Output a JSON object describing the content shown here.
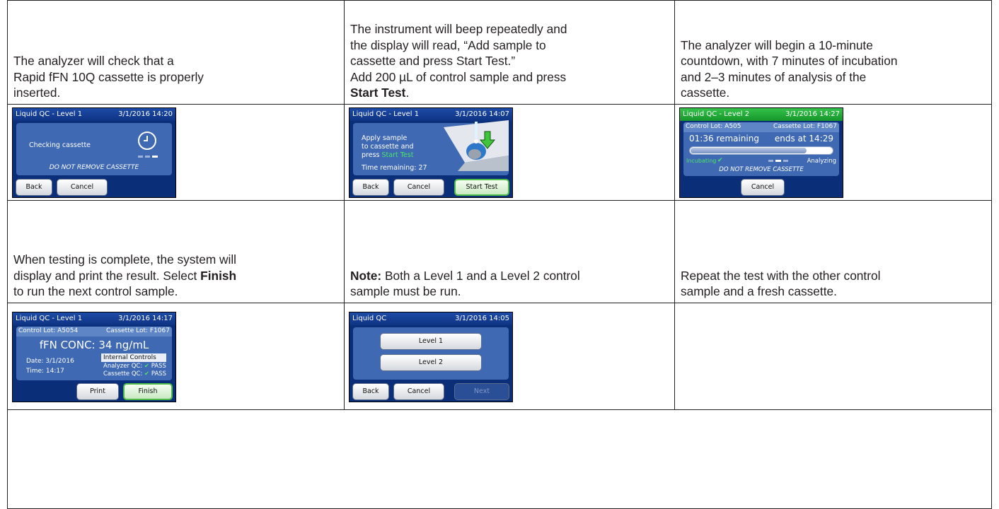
{
  "instructions": {
    "r1c1": [
      "The analyzer will check that a",
      "Rapid fFN 10Q cassette is properly",
      "inserted."
    ],
    "r1c2_pre": [
      "The instrument will beep repeatedly and",
      "the display will read, “Add sample to",
      "cassette and press Start Test.”",
      "Add 200 µL of control sample and press"
    ],
    "r1c2_bold": "Start Test",
    "r1c2_end": ".",
    "r1c3": [
      "The analyzer will begin a 10-minute",
      "countdown, with 7 minutes of incubation",
      "and 2–3 minutes of analysis of the",
      "cassette."
    ],
    "r2c1_pre": [
      "When testing is complete, the system will",
      "display and print the result. Select "
    ],
    "r2c1_bold": "Finish",
    "r2c1_post": "to run the next control sample.",
    "r2c2_bold": "Note:",
    "r2c2_post": [
      " Both a Level 1 and a Level 2 control",
      "sample must be run."
    ],
    "r2c3": [
      "Repeat the test with the other control",
      "sample and a fresh cassette."
    ]
  },
  "screens": {
    "s1": {
      "title": "Liquid QC - Level 1",
      "datetime": "3/1/2016 14:20",
      "message": "Checking cassette",
      "warning": "DO NOT REMOVE CASSETTE",
      "back": "Back",
      "cancel": "Cancel"
    },
    "s2": {
      "title": "Liquid QC - Level 1",
      "datetime": "3/1/2016 14:07",
      "line1": "Apply sample",
      "line2": "to cassette and",
      "line3": "press",
      "start_word": "Start Test",
      "time_remaining": "Time remaining: 27",
      "back": "Back",
      "cancel": "Cancel",
      "start": "Start Test"
    },
    "s3": {
      "title": "Liquid QC - Level 2",
      "datetime": "3/1/2016 14:27",
      "control_lot": "Control Lot: A505",
      "cassette_lot": "Cassette Lot: F1067",
      "remaining": "01:36 remaining",
      "ends": "ends at 14:29",
      "incubating": "Incubating",
      "analyzing": "Analyzing",
      "progress": 0.82,
      "warning": "DO NOT REMOVE CASSETTE",
      "cancel": "Cancel"
    },
    "s4": {
      "title": "Liquid QC - Level 1",
      "datetime": "3/1/2016 14:17",
      "control_lot": "Control Lot: A5054",
      "cassette_lot": "Cassette Lot: F1067",
      "result": "fFN CONC: 34 ng/mL",
      "date": "Date: 3/1/2016",
      "time": "Time: 14:17",
      "internal": "Internal Controls",
      "analyzer_qc": "Analyzer QC:",
      "cassette_qc": "Cassette QC:",
      "pass": "PASS",
      "print": "Print",
      "finish": "Finish"
    },
    "s5": {
      "title": "Liquid QC",
      "datetime": "3/1/2016 14:05",
      "level1": "Level 1",
      "level2": "Level 2",
      "back": "Back",
      "cancel": "Cancel",
      "next": "Next"
    }
  },
  "colors": {
    "screen_bg": "#0b2e79",
    "panel": "#3f69b3",
    "accent_green": "#4ebb46"
  }
}
